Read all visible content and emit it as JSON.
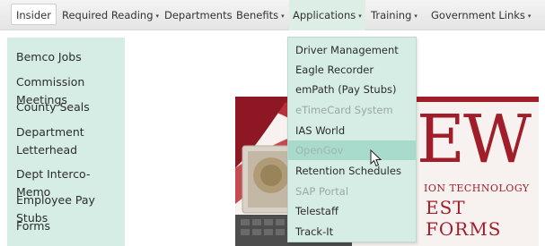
{
  "nav": {
    "items": [
      {
        "label": "Insider",
        "caret": ""
      },
      {
        "label": "Required Reading",
        "caret": "▾"
      },
      {
        "label": "Departments",
        "caret": ""
      },
      {
        "label": "Benefits",
        "caret": "▾"
      },
      {
        "label": "Applications",
        "caret": "▾"
      },
      {
        "label": "Training",
        "caret": "▾"
      },
      {
        "label": "Government Links",
        "caret": "▾"
      }
    ]
  },
  "sidebar": {
    "items": [
      {
        "label": "Bemco Jobs"
      },
      {
        "label": "Commission Meetings"
      },
      {
        "label": "County Seals"
      },
      {
        "label": "Department Letterhead"
      },
      {
        "label": "Dept Interco-Memo"
      },
      {
        "label": "Employee Pay Stubs"
      },
      {
        "label": "Forms"
      }
    ]
  },
  "applications_menu": {
    "items": [
      {
        "label": "Driver Management"
      },
      {
        "label": "Eagle Recorder"
      },
      {
        "label": "emPath (Pay Stubs)"
      },
      {
        "label": "eTimeCard System"
      },
      {
        "label": "IAS World"
      },
      {
        "label": "OpenGov"
      },
      {
        "label": "Retention Schedules"
      },
      {
        "label": "SAP Portal"
      },
      {
        "label": "Telestaff"
      },
      {
        "label": "Track-It"
      }
    ]
  },
  "hero": {
    "big_text": "EW",
    "line1": "ION TECHNOLOGY",
    "line2": "EST FORMS"
  },
  "colors": {
    "menu_bg": "#d6ede5",
    "menu_hover": "#a9dbcc",
    "banner_red": "#a11d2a"
  }
}
